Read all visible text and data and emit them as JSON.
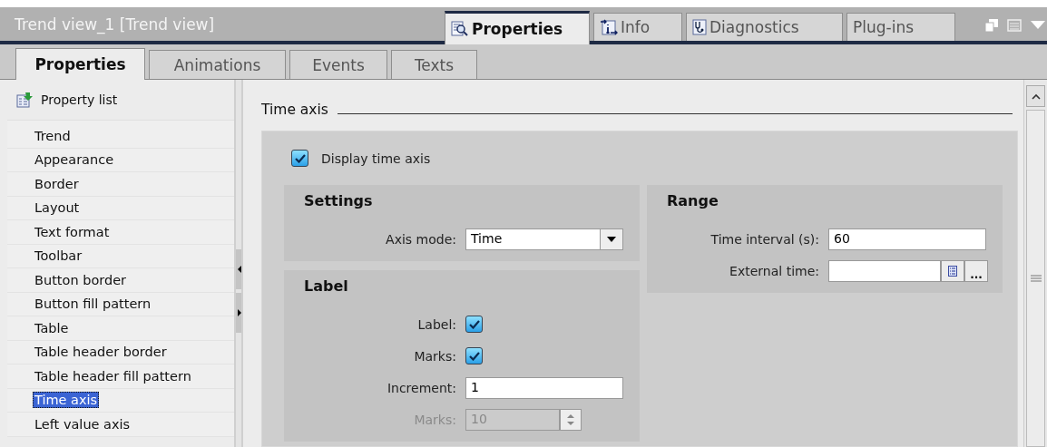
{
  "panel": {
    "title": "Trend view_1 [Trend view]"
  },
  "inspector_tabs": [
    {
      "label": "Properties",
      "selected": true
    },
    {
      "label": "Info",
      "selected": false
    },
    {
      "label": "Diagnostics",
      "selected": false
    },
    {
      "label": "Plug-ins",
      "selected": false
    }
  ],
  "tabs": [
    {
      "label": "Properties",
      "selected": true
    },
    {
      "label": "Animations",
      "selected": false
    },
    {
      "label": "Events",
      "selected": false
    },
    {
      "label": "Texts",
      "selected": false
    }
  ],
  "sidebar": {
    "header": "Property list",
    "items": [
      {
        "label": "Trend",
        "selected": false
      },
      {
        "label": "Appearance",
        "selected": false
      },
      {
        "label": "Border",
        "selected": false
      },
      {
        "label": "Layout",
        "selected": false
      },
      {
        "label": "Text format",
        "selected": false
      },
      {
        "label": "Toolbar",
        "selected": false
      },
      {
        "label": "Button border",
        "selected": false
      },
      {
        "label": "Button fill pattern",
        "selected": false
      },
      {
        "label": "Table",
        "selected": false
      },
      {
        "label": "Table header border",
        "selected": false
      },
      {
        "label": "Table header fill pattern",
        "selected": false
      },
      {
        "label": "Time axis",
        "selected": true
      },
      {
        "label": "Left value axis",
        "selected": false
      }
    ]
  },
  "section": {
    "title": "Time axis",
    "display_option": {
      "label": "Display time axis",
      "checked": true
    },
    "columns": [
      [
        {
          "title": "Settings",
          "rows": [
            {
              "kind": "dropdown",
              "label": "Axis mode:",
              "value": "Time"
            }
          ]
        },
        {
          "title": "Label",
          "rows": [
            {
              "kind": "checkbox",
              "label": "Label:",
              "checked": true
            },
            {
              "kind": "checkbox",
              "label": "Marks:",
              "checked": true
            },
            {
              "kind": "text",
              "label": "Increment:",
              "value": "1"
            },
            {
              "kind": "spin",
              "label": "Marks:",
              "value": "10",
              "disabled": true
            }
          ]
        }
      ],
      [
        {
          "title": "Range",
          "rows": [
            {
              "kind": "text",
              "label": "Time interval (s):",
              "value": "60"
            },
            {
              "kind": "browse",
              "label": "External time:",
              "button": "..."
            }
          ]
        }
      ]
    ]
  }
}
